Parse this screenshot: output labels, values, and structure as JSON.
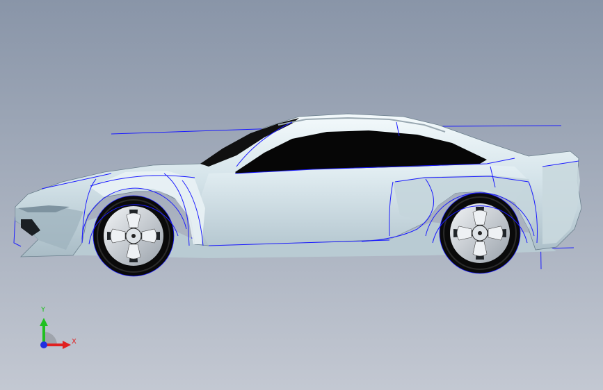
{
  "viewport": {
    "background_top": "#8995a8",
    "background_bottom": "#c3c8d2"
  },
  "model": {
    "body_color": "#d8e5ea",
    "sketch_line_color": "#1a1aff",
    "glass_color": "#060606",
    "tire_color": "#0a0a0a",
    "wheels": [
      "front-wheel",
      "rear-wheel"
    ]
  },
  "triad": {
    "x_label": "X",
    "y_label": "Y",
    "x_color": "#e02020",
    "y_color": "#20c020",
    "origin_color": "#2030e0"
  }
}
